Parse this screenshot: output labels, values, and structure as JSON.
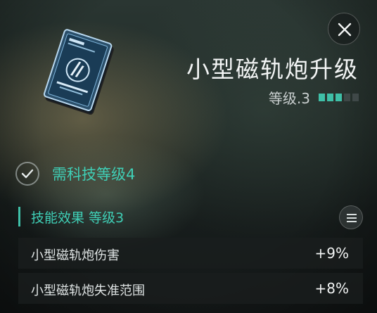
{
  "module": {
    "title": "小型磁轨炮升级",
    "level_text": "等级.3",
    "level_current": 3,
    "level_max": 5,
    "accent_color": "#3fc0a8"
  },
  "requirement": {
    "text": "需科技等级4",
    "icon": "check-icon"
  },
  "section": {
    "title": "技能效果 等级3",
    "menu_icon": "menu-icon"
  },
  "stats": [
    {
      "label": "小型磁轨炮伤害",
      "value": "+9%"
    },
    {
      "label": "小型磁轨炮失准范围",
      "value": "+8%"
    }
  ],
  "close_icon": "close-icon"
}
